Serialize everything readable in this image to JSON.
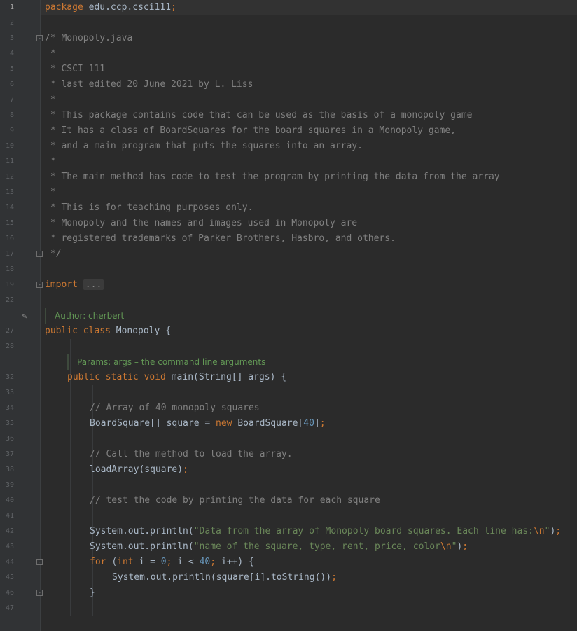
{
  "editor": {
    "current_line": "1",
    "lines": [
      {
        "n": "1",
        "indent": 0,
        "tokens": [
          {
            "c": "kw",
            "t": "package "
          },
          {
            "c": "plain",
            "t": "edu.ccp.csci111"
          },
          {
            "c": "kw",
            "t": ";"
          }
        ]
      },
      {
        "n": "2",
        "indent": 0,
        "tokens": []
      },
      {
        "n": "3",
        "indent": 0,
        "fold": true,
        "tokens": [
          {
            "c": "cm",
            "t": "/* Monopoly.java"
          }
        ]
      },
      {
        "n": "4",
        "indent": 0,
        "tokens": [
          {
            "c": "cm",
            "t": " *"
          }
        ]
      },
      {
        "n": "5",
        "indent": 0,
        "tokens": [
          {
            "c": "cm",
            "t": " * CSCI 111"
          }
        ]
      },
      {
        "n": "6",
        "indent": 0,
        "tokens": [
          {
            "c": "cm",
            "t": " * last edited 20 June 2021 by L. Liss"
          }
        ]
      },
      {
        "n": "7",
        "indent": 0,
        "tokens": [
          {
            "c": "cm",
            "t": " *"
          }
        ]
      },
      {
        "n": "8",
        "indent": 0,
        "tokens": [
          {
            "c": "cm",
            "t": " * This package contains code that can be used as the basis of a monopoly game"
          }
        ]
      },
      {
        "n": "9",
        "indent": 0,
        "tokens": [
          {
            "c": "cm",
            "t": " * It has a class of BoardSquares for the board squares in a Monopoly game,"
          }
        ]
      },
      {
        "n": "10",
        "indent": 0,
        "tokens": [
          {
            "c": "cm",
            "t": " * and a main program that puts the squares into an array."
          }
        ]
      },
      {
        "n": "11",
        "indent": 0,
        "tokens": [
          {
            "c": "cm",
            "t": " *"
          }
        ]
      },
      {
        "n": "12",
        "indent": 0,
        "tokens": [
          {
            "c": "cm",
            "t": " * The main method has code to test the program by printing the data from the array"
          }
        ]
      },
      {
        "n": "13",
        "indent": 0,
        "tokens": [
          {
            "c": "cm",
            "t": " *"
          }
        ]
      },
      {
        "n": "14",
        "indent": 0,
        "tokens": [
          {
            "c": "cm",
            "t": " * This is for teaching purposes only."
          }
        ]
      },
      {
        "n": "15",
        "indent": 0,
        "tokens": [
          {
            "c": "cm",
            "t": " * Monopoly and the names and images used in Monopoly are"
          }
        ]
      },
      {
        "n": "16",
        "indent": 0,
        "tokens": [
          {
            "c": "cm",
            "t": " * registered trademarks of Parker Brothers, Hasbro, and others."
          }
        ]
      },
      {
        "n": "17",
        "indent": 0,
        "fold": true,
        "tokens": [
          {
            "c": "cm",
            "t": " */"
          }
        ]
      },
      {
        "n": "18",
        "indent": 0,
        "tokens": []
      },
      {
        "n": "19",
        "indent": 0,
        "fold": true,
        "tokens": [
          {
            "c": "kw",
            "t": "import "
          },
          {
            "c": "fold-block",
            "t": "..."
          }
        ]
      },
      {
        "n": "22",
        "indent": 0,
        "tokens": []
      },
      {
        "n": "",
        "indent": 0,
        "doc": "Author: cherbert",
        "pencil": true,
        "tokens": []
      },
      {
        "n": "27",
        "indent": 0,
        "tokens": [
          {
            "c": "kw",
            "t": "public class "
          },
          {
            "c": "plain",
            "t": "Monopoly {"
          }
        ]
      },
      {
        "n": "28",
        "indent": 0,
        "tokens": []
      },
      {
        "n": "",
        "indent": 1,
        "doc": "Params: args – the command line arguments",
        "tokens": []
      },
      {
        "n": "32",
        "indent": 1,
        "tokens": [
          {
            "c": "kw",
            "t": "public static void "
          },
          {
            "c": "plain",
            "t": "main(String[] args) {"
          }
        ]
      },
      {
        "n": "33",
        "indent": 0,
        "tokens": []
      },
      {
        "n": "34",
        "indent": 2,
        "tokens": [
          {
            "c": "cm",
            "t": "// Array of 40 monopoly squares"
          }
        ]
      },
      {
        "n": "35",
        "indent": 2,
        "tokens": [
          {
            "c": "plain",
            "t": "BoardSquare[] square = "
          },
          {
            "c": "kw",
            "t": "new "
          },
          {
            "c": "plain",
            "t": "BoardSquare["
          },
          {
            "c": "num",
            "t": "40"
          },
          {
            "c": "plain",
            "t": "]"
          },
          {
            "c": "kw",
            "t": ";"
          }
        ]
      },
      {
        "n": "36",
        "indent": 0,
        "tokens": []
      },
      {
        "n": "37",
        "indent": 2,
        "tokens": [
          {
            "c": "cm",
            "t": "// Call the method to load the array."
          }
        ]
      },
      {
        "n": "38",
        "indent": 2,
        "tokens": [
          {
            "c": "plain",
            "t": "loadArray(square)"
          },
          {
            "c": "kw",
            "t": ";"
          }
        ]
      },
      {
        "n": "39",
        "indent": 0,
        "tokens": []
      },
      {
        "n": "40",
        "indent": 2,
        "tokens": [
          {
            "c": "cm",
            "t": "// test the code by printing the data for each square"
          }
        ]
      },
      {
        "n": "41",
        "indent": 0,
        "tokens": []
      },
      {
        "n": "42",
        "indent": 2,
        "tokens": [
          {
            "c": "plain",
            "t": "System.out.println("
          },
          {
            "c": "str",
            "t": "\"Data from the array of Monopoly board squares. Each line has:"
          },
          {
            "c": "esc",
            "t": "\\n"
          },
          {
            "c": "str",
            "t": "\""
          },
          {
            "c": "plain",
            "t": ")"
          },
          {
            "c": "kw",
            "t": ";"
          }
        ]
      },
      {
        "n": "43",
        "indent": 2,
        "tokens": [
          {
            "c": "plain",
            "t": "System.out.println("
          },
          {
            "c": "str",
            "t": "\"name of the square, type, rent, price, color"
          },
          {
            "c": "esc",
            "t": "\\n"
          },
          {
            "c": "str",
            "t": "\""
          },
          {
            "c": "plain",
            "t": ")"
          },
          {
            "c": "kw",
            "t": ";"
          }
        ]
      },
      {
        "n": "44",
        "indent": 2,
        "fold": true,
        "tokens": [
          {
            "c": "kw",
            "t": "for "
          },
          {
            "c": "plain",
            "t": "("
          },
          {
            "c": "kw",
            "t": "int "
          },
          {
            "c": "plain",
            "t": "i = "
          },
          {
            "c": "num",
            "t": "0"
          },
          {
            "c": "kw",
            "t": "; "
          },
          {
            "c": "plain",
            "t": "i < "
          },
          {
            "c": "num",
            "t": "40"
          },
          {
            "c": "kw",
            "t": "; "
          },
          {
            "c": "plain",
            "t": "i++) {"
          }
        ]
      },
      {
        "n": "45",
        "indent": 3,
        "tokens": [
          {
            "c": "plain",
            "t": "System.out.println(square[i].toString())"
          },
          {
            "c": "kw",
            "t": ";"
          }
        ]
      },
      {
        "n": "46",
        "indent": 2,
        "fold": true,
        "tokens": [
          {
            "c": "plain",
            "t": "}"
          }
        ]
      },
      {
        "n": "47",
        "indent": 0,
        "tokens": []
      }
    ]
  }
}
